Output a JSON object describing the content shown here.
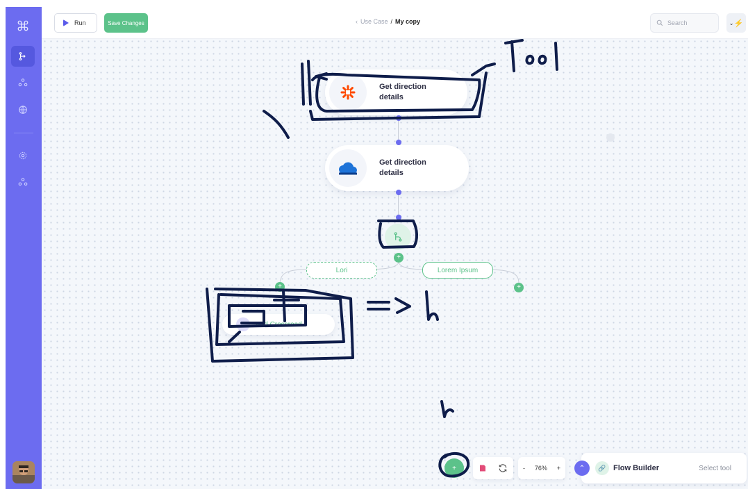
{
  "sidebar": {
    "icons": [
      "command-icon",
      "flow-icon",
      "team-icon",
      "globe-icon",
      "settings-icon",
      "network-icon"
    ]
  },
  "header": {
    "run_label": "Run",
    "save_label": "Save Changes",
    "breadcrumb_parent": "Use Case",
    "breadcrumb_sep": "/",
    "breadcrumb_current": "My copy",
    "search_placeholder": "Search"
  },
  "nodes": [
    {
      "title": "Get direction details",
      "icon": "zapier-icon"
    },
    {
      "title": "Get direction details",
      "icon": "cloud-icon"
    }
  ],
  "branches": {
    "left_label": "Lori",
    "right_label": "Lorem Ipsum",
    "add_crossroad_label": "Add Crossroad"
  },
  "bottom": {
    "zoom_minus": "-",
    "zoom_value": "76%",
    "zoom_plus": "+",
    "panel_title": "Flow Builder",
    "panel_action": "Select tool"
  },
  "annotations": {
    "tool_note": "Tool"
  },
  "colors": {
    "sidebar": "#6c6cf0",
    "accent_green": "#5cc28a",
    "node_dot": "#6c6cf0",
    "ink": "#0f1d4a"
  }
}
